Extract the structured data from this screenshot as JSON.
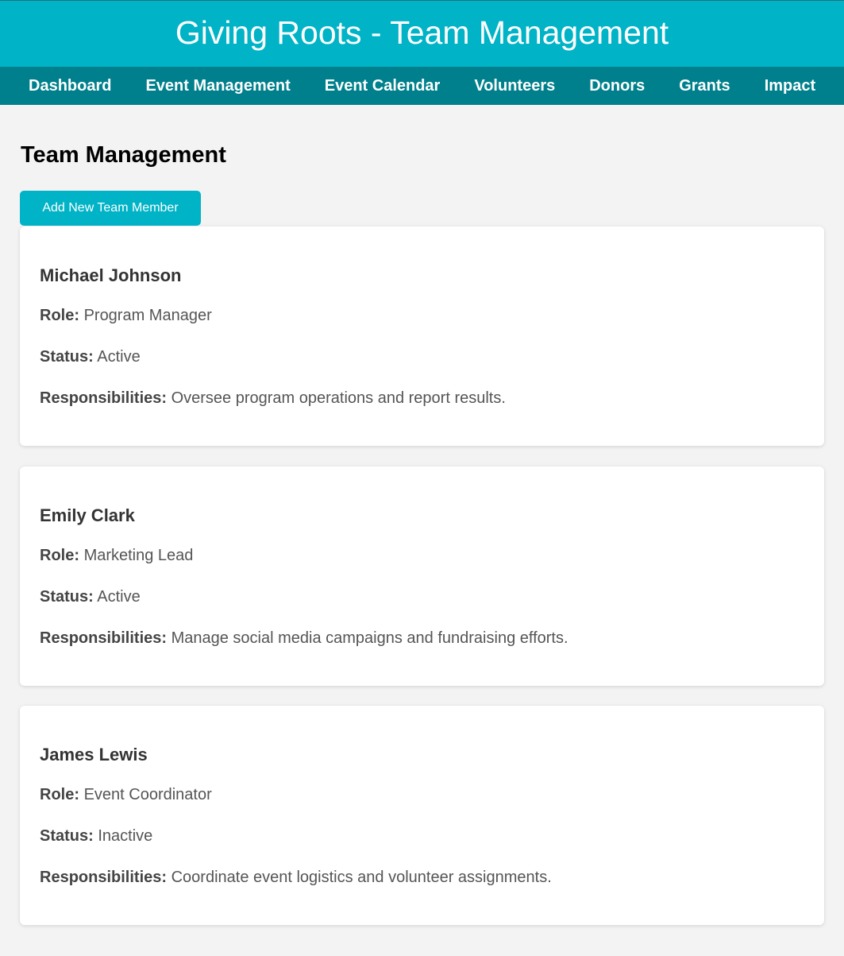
{
  "app": {
    "title": "Giving Roots - Team Management",
    "accent_color": "#00b3c6",
    "nav_color": "#00808c"
  },
  "nav": {
    "items": [
      {
        "label": "Dashboard"
      },
      {
        "label": "Event Management"
      },
      {
        "label": "Event Calendar"
      },
      {
        "label": "Volunteers"
      },
      {
        "label": "Donors"
      },
      {
        "label": "Grants"
      },
      {
        "label": "Impact"
      }
    ]
  },
  "page": {
    "title": "Team Management",
    "add_button_label": "Add New Team Member"
  },
  "labels": {
    "role": "Role:",
    "status": "Status:",
    "responsibilities": "Responsibilities:"
  },
  "team": [
    {
      "name": "Michael Johnson",
      "role": "Program Manager",
      "status": "Active",
      "responsibilities": "Oversee program operations and report results."
    },
    {
      "name": "Emily Clark",
      "role": "Marketing Lead",
      "status": "Active",
      "responsibilities": "Manage social media campaigns and fundraising efforts."
    },
    {
      "name": "James Lewis",
      "role": "Event Coordinator",
      "status": "Inactive",
      "responsibilities": "Coordinate event logistics and volunteer assignments."
    }
  ]
}
